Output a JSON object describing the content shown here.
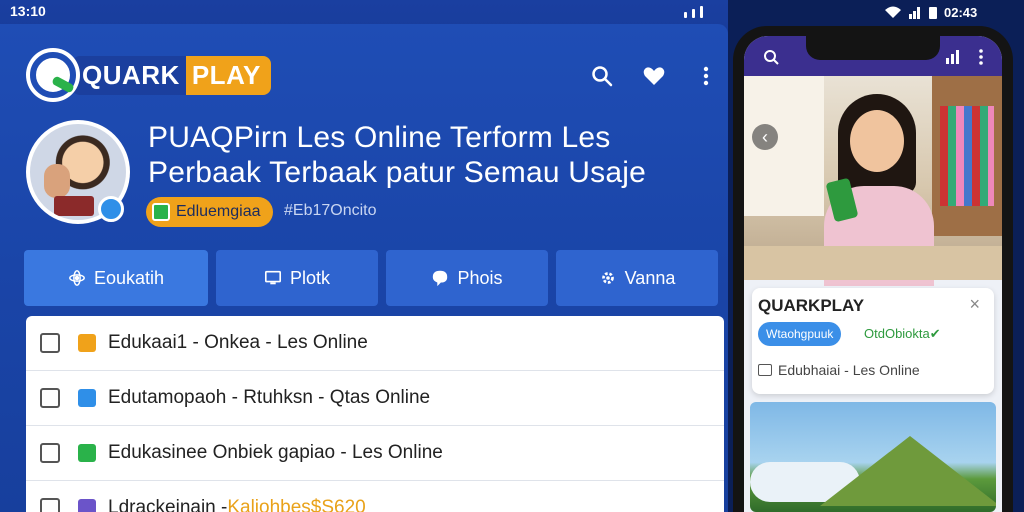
{
  "status": {
    "time": "13:10",
    "time_right": "02:43"
  },
  "brand": {
    "quark": "QUARK",
    "play": "PLAY"
  },
  "colors": {
    "primary": "#1f4db5",
    "accent": "#f0a21a",
    "success": "#2ab24a",
    "phone_bg": "#141414"
  },
  "header_icons": [
    "search-icon",
    "heart-icon",
    "more-vertical-icon"
  ],
  "profile": {
    "headline_1": "PUAQPirn Les Online Terform Les",
    "headline_2": "Perbaak Terbaak patur Semau Usaje",
    "chip": "Edluemgiaa",
    "meta": "#Eb17Oncito"
  },
  "tabs": [
    {
      "label": "Eoukatih",
      "icon": "atom-icon"
    },
    {
      "label": "Plotk",
      "icon": "monitor-icon"
    },
    {
      "label": "Phois",
      "icon": "chat-icon"
    },
    {
      "label": "Vanna",
      "icon": "gear-icon"
    }
  ],
  "list": [
    {
      "label": "Edukaai1 - Onkea  - Les Online",
      "color": "#f0a21a"
    },
    {
      "label": "Edutamopaoh - Rtuhksn - Qtas Online",
      "color": "#2f8fe8"
    },
    {
      "label": "Edukasinee Onbiek gapiao - Les Online",
      "color": "#2ab24a"
    },
    {
      "label": "Ldrackeinain - ",
      "highlight": "Kaliohbes$S620",
      "color": "#6b54c9"
    }
  ],
  "phone": {
    "card_title": "QUARKPLAY",
    "card_pill": "Wtaohgpuuk",
    "card_green": "OtdObiokta✔",
    "card_line": "Edubhaiai - Les Online",
    "close": "×",
    "back": "‹"
  }
}
